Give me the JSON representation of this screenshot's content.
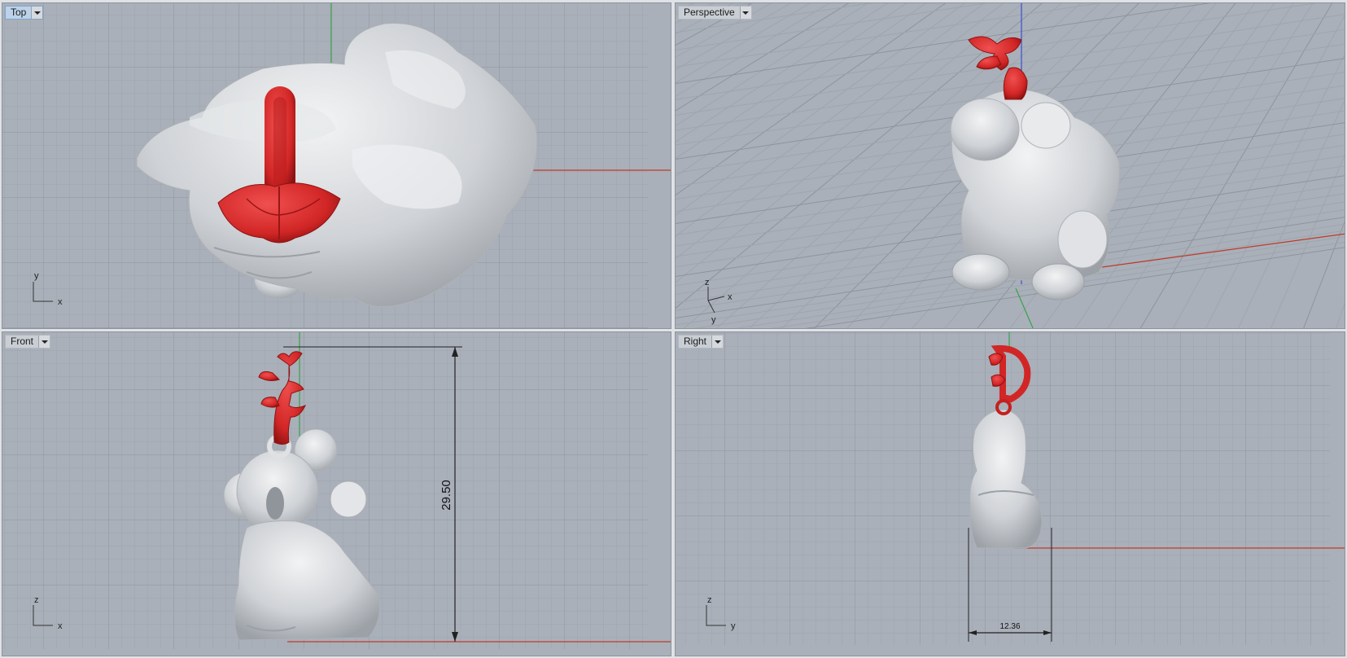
{
  "viewports": {
    "top": {
      "label": "Top",
      "axes": [
        "y",
        "x"
      ]
    },
    "perspective": {
      "label": "Perspective",
      "axes": [
        "z",
        "x",
        "y"
      ]
    },
    "front": {
      "label": "Front",
      "axes": [
        "z",
        "x"
      ],
      "dimension": "29.50"
    },
    "right": {
      "label": "Right",
      "axes": [
        "z",
        "y"
      ],
      "dimension": "12.36"
    }
  },
  "colors": {
    "viewport_bg": "#a9b0b9",
    "model_silver": "#d9dbde",
    "model_red": "#d42a2a",
    "axis_x": "#c0392b",
    "axis_y": "#3aa04a",
    "axis_z": "#3b4fd6",
    "grid_major": "#8d949c",
    "grid_minor": "#9ea5ad"
  },
  "icons": [
    "dropdown-arrow-icon",
    "axis-widget-icon"
  ]
}
